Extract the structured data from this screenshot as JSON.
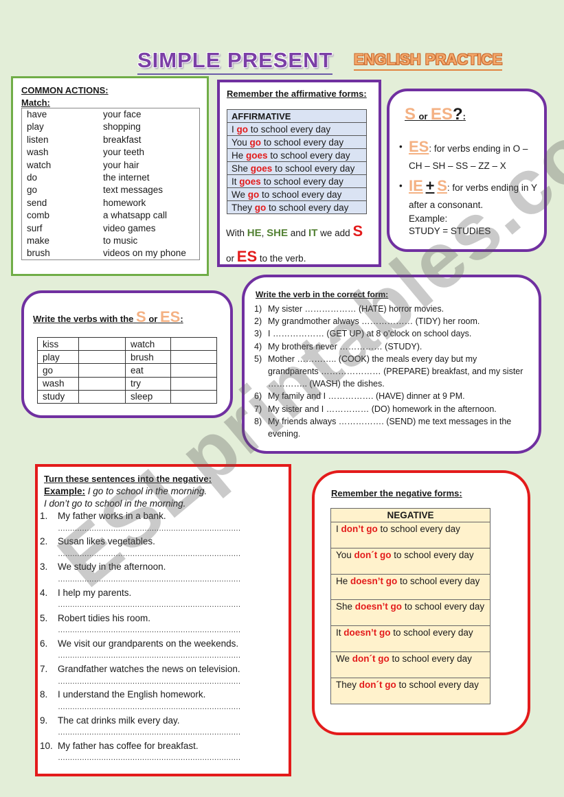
{
  "header": {
    "title": "SIMPLE PRESENT",
    "subtitle": "ENGLISH PRACTICE"
  },
  "common_actions": {
    "heading": "COMMON ACTIONS:",
    "instruction": "Match:",
    "rows": [
      {
        "verb": "have",
        "object": "your face"
      },
      {
        "verb": "play",
        "object": "shopping"
      },
      {
        "verb": "listen",
        "object": "breakfast"
      },
      {
        "verb": "wash",
        "object": "your teeth"
      },
      {
        "verb": "watch",
        "object": "your hair"
      },
      {
        "verb": "do",
        "object": "the internet"
      },
      {
        "verb": "go",
        "object": "text messages"
      },
      {
        "verb": "send",
        "object": "homework"
      },
      {
        "verb": "comb",
        "object": "a whatsapp call"
      },
      {
        "verb": "surf",
        "object": "video games"
      },
      {
        "verb": "make",
        "object": "to music"
      },
      {
        "verb": "brush",
        "object": "videos on my phone"
      }
    ]
  },
  "affirmative": {
    "heading": "Remember the affirmative forms:",
    "table_header": "AFFIRMATIVE",
    "rows": [
      {
        "subject": "I",
        "verb": "go",
        "rest": "to school every day"
      },
      {
        "subject": "You",
        "verb": "go",
        "rest": "to school every day"
      },
      {
        "subject": "He",
        "verb": "goes",
        "rest": "to school every day"
      },
      {
        "subject": "She",
        "verb": "goes",
        "rest": "to school every day"
      },
      {
        "subject": "It",
        "verb": "goes",
        "rest": "to school every day"
      },
      {
        "subject": "We",
        "verb": "go",
        "rest": "to school every day"
      },
      {
        "subject": "They",
        "verb": "go",
        "rest": "to school every day"
      }
    ],
    "note": {
      "with": "With",
      "he": "HE",
      "comma": ",",
      "she": "SHE",
      "and": "and",
      "it": "IT",
      "we_add": "we add",
      "s": "S",
      "or": "or",
      "es": "ES",
      "to_the_verb": "to the verb."
    }
  },
  "s_or_es": {
    "title_s": "S",
    "title_or": "or",
    "title_es": "ES",
    "title_q": "?",
    "title_colon": ":",
    "rule1_label": "ES",
    "rule1_text": ": for verbs ending in O – CH – SH – SS – ZZ – X",
    "rule2_label_ie": "IE",
    "rule2_plus": "+",
    "rule2_label_s": "S",
    "rule2_text": ": for verbs ending in Y after a consonant.",
    "example_label": "Example:",
    "example": "STUDY = STUDIES"
  },
  "write_verbs": {
    "heading": "Write the verbs with the",
    "s": "S",
    "or": "or",
    "es": "ES",
    "colon": ":",
    "rows": [
      {
        "left": "kiss",
        "left_answer": "",
        "right": "watch",
        "right_answer": ""
      },
      {
        "left": "play",
        "left_answer": "",
        "right": "brush",
        "right_answer": ""
      },
      {
        "left": "go",
        "left_answer": "",
        "right": "eat",
        "right_answer": ""
      },
      {
        "left": "wash",
        "left_answer": "",
        "right": "try",
        "right_answer": ""
      },
      {
        "left": "study",
        "left_answer": "",
        "right": "sleep",
        "right_answer": ""
      }
    ]
  },
  "verb_form": {
    "heading": "Write the verb in the correct form:",
    "items": [
      {
        "n": "1)",
        "text": "My sister ……………… (HATE) horror movies."
      },
      {
        "n": "2)",
        "text": "My grandmother always ……………… (TIDY) her room."
      },
      {
        "n": "3)",
        "text": "I ……………… (GET UP) at 8 o’clock on school days."
      },
      {
        "n": "4)",
        "text": "My brothers never …………… (STUDY)."
      },
      {
        "n": "5)",
        "text": "Mother ………….. (COOK) the meals every day but my grandparents ………………… (PREPARE) breakfast, and my sister ………….. (WASH) the dishes."
      },
      {
        "n": "6)",
        "text": "My family and I ……………. (HAVE) dinner at 9 PM."
      },
      {
        "n": "7)",
        "text": "My sister and I …………… (DO) homework in the afternoon."
      },
      {
        "n": "8)",
        "text": "My friends always ……………. (SEND) me text messages in the evening."
      }
    ]
  },
  "negative_exercise": {
    "heading": "Turn these sentences into the negative:",
    "example_label": "Example:",
    "example_sentence": "I go to school in the morning.",
    "example_answer": "I don’t go to school in the morning.",
    "answer_line": "………………………………………………………………………………",
    "items": [
      {
        "n": "1.",
        "text": "My father works in a bank."
      },
      {
        "n": "2.",
        "text": "Susan likes vegetables."
      },
      {
        "n": "3.",
        "text": "We study in the afternoon."
      },
      {
        "n": "4.",
        "text": "I help my parents."
      },
      {
        "n": "5.",
        "text": "Robert tidies his room."
      },
      {
        "n": "6.",
        "text": "We visit our grandparents on the weekends."
      },
      {
        "n": "7.",
        "text": "Grandfather watches the news on television."
      },
      {
        "n": "8.",
        "text": "I understand the English homework."
      },
      {
        "n": "9.",
        "text": "The cat drinks milk every day."
      },
      {
        "n": "10.",
        "text": "My father has coffee for breakfast."
      }
    ]
  },
  "negative_forms": {
    "heading": "Remember the negative forms:",
    "table_header": "NEGATIVE",
    "rows": [
      {
        "subject": "I",
        "verb": "don’t go",
        "rest": "to school every day"
      },
      {
        "subject": "You",
        "verb": "don´t go",
        "rest": "to school every day"
      },
      {
        "subject": "He",
        "verb": "doesn’t go",
        "rest": "to school every day"
      },
      {
        "subject": "She",
        "verb": "doesn’t go",
        "rest": "to school every day"
      },
      {
        "subject": "It",
        "verb": "doesn’t go",
        "rest": "to school every day"
      },
      {
        "subject": "We",
        "verb": "don´t go",
        "rest": "to school every day"
      },
      {
        "subject": "They",
        "verb": "don´t go",
        "rest": "to school every day"
      }
    ]
  },
  "watermark": "ESLprintables.com",
  "colors": {
    "background": "#e3eed8",
    "purple": "#7030a0",
    "green": "#70ad47",
    "red": "#e31b1b",
    "orange": "#f4b183",
    "affirmative_fill": "#dae3f3",
    "negative_fill": "#fff2cc"
  }
}
